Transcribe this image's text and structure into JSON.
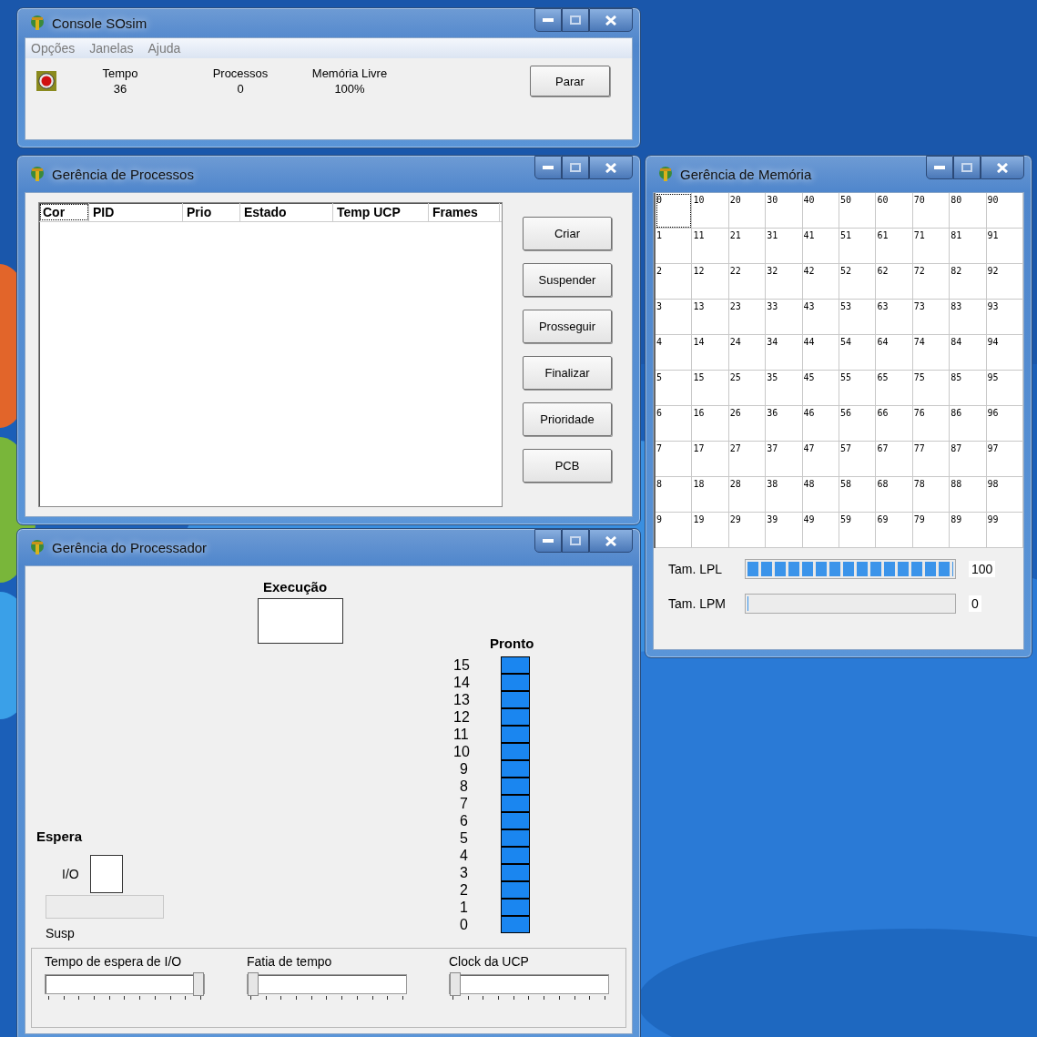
{
  "windows": [
    {
      "kind": "console",
      "title": "Console SOsim",
      "menu": [
        "Opções",
        "Janelas",
        "Ajuda"
      ],
      "stats": [
        {
          "label": "Tempo",
          "value": "36"
        },
        {
          "label": "Processos",
          "value": "0"
        },
        {
          "label": "Memória Livre",
          "value": "100%"
        }
      ],
      "button": "Parar"
    },
    {
      "kind": "processes",
      "title": "Gerência de Processos",
      "columns": [
        "Cor",
        "PID",
        "Prio",
        "Estado",
        "Temp UCP",
        "Frames"
      ],
      "buttons": [
        "Criar",
        "Suspender",
        "Prosseguir",
        "Finalizar",
        "Prioridade",
        "PCB"
      ]
    },
    {
      "kind": "memory",
      "title": "Gerência de Memória",
      "cells": [
        {
          "label": "0",
          "selected": true
        },
        {
          "label": "1",
          "selected": false
        },
        {
          "label": "2",
          "selected": false
        },
        {
          "label": "3",
          "selected": false
        },
        {
          "label": "4",
          "selected": false
        },
        {
          "label": "5",
          "selected": false
        },
        {
          "label": "6",
          "selected": false
        },
        {
          "label": "7",
          "selected": false
        },
        {
          "label": "8",
          "selected": false
        },
        {
          "label": "9",
          "selected": false
        },
        {
          "label": "10",
          "selected": false
        },
        {
          "label": "11",
          "selected": false
        },
        {
          "label": "12",
          "selected": false
        },
        {
          "label": "13",
          "selected": false
        },
        {
          "label": "14",
          "selected": false
        },
        {
          "label": "15",
          "selected": false
        },
        {
          "label": "16",
          "selected": false
        },
        {
          "label": "17",
          "selected": false
        },
        {
          "label": "18",
          "selected": false
        },
        {
          "label": "19",
          "selected": false
        },
        {
          "label": "20",
          "selected": false
        },
        {
          "label": "21",
          "selected": false
        },
        {
          "label": "22",
          "selected": false
        },
        {
          "label": "23",
          "selected": false
        },
        {
          "label": "24",
          "selected": false
        },
        {
          "label": "25",
          "selected": false
        },
        {
          "label": "26",
          "selected": false
        },
        {
          "label": "27",
          "selected": false
        },
        {
          "label": "28",
          "selected": false
        },
        {
          "label": "29",
          "selected": false
        },
        {
          "label": "30",
          "selected": false
        },
        {
          "label": "31",
          "selected": false
        },
        {
          "label": "32",
          "selected": false
        },
        {
          "label": "33",
          "selected": false
        },
        {
          "label": "34",
          "selected": false
        },
        {
          "label": "35",
          "selected": false
        },
        {
          "label": "36",
          "selected": false
        },
        {
          "label": "37",
          "selected": false
        },
        {
          "label": "38",
          "selected": false
        },
        {
          "label": "39",
          "selected": false
        },
        {
          "label": "40",
          "selected": false
        },
        {
          "label": "41",
          "selected": false
        },
        {
          "label": "42",
          "selected": false
        },
        {
          "label": "43",
          "selected": false
        },
        {
          "label": "44",
          "selected": false
        },
        {
          "label": "45",
          "selected": false
        },
        {
          "label": "46",
          "selected": false
        },
        {
          "label": "47",
          "selected": false
        },
        {
          "label": "48",
          "selected": false
        },
        {
          "label": "49",
          "selected": false
        },
        {
          "label": "50",
          "selected": false
        },
        {
          "label": "51",
          "selected": false
        },
        {
          "label": "52",
          "selected": false
        },
        {
          "label": "53",
          "selected": false
        },
        {
          "label": "54",
          "selected": false
        },
        {
          "label": "55",
          "selected": false
        },
        {
          "label": "56",
          "selected": false
        },
        {
          "label": "57",
          "selected": false
        },
        {
          "label": "58",
          "selected": false
        },
        {
          "label": "59",
          "selected": false
        },
        {
          "label": "60",
          "selected": false
        },
        {
          "label": "61",
          "selected": false
        },
        {
          "label": "62",
          "selected": false
        },
        {
          "label": "63",
          "selected": false
        },
        {
          "label": "64",
          "selected": false
        },
        {
          "label": "65",
          "selected": false
        },
        {
          "label": "66",
          "selected": false
        },
        {
          "label": "67",
          "selected": false
        },
        {
          "label": "68",
          "selected": false
        },
        {
          "label": "69",
          "selected": false
        },
        {
          "label": "70",
          "selected": false
        },
        {
          "label": "71",
          "selected": false
        },
        {
          "label": "72",
          "selected": false
        },
        {
          "label": "73",
          "selected": false
        },
        {
          "label": "74",
          "selected": false
        },
        {
          "label": "75",
          "selected": false
        },
        {
          "label": "76",
          "selected": false
        },
        {
          "label": "77",
          "selected": false
        },
        {
          "label": "78",
          "selected": false
        },
        {
          "label": "79",
          "selected": false
        },
        {
          "label": "80",
          "selected": false
        },
        {
          "label": "81",
          "selected": false
        },
        {
          "label": "82",
          "selected": false
        },
        {
          "label": "83",
          "selected": false
        },
        {
          "label": "84",
          "selected": false
        },
        {
          "label": "85",
          "selected": false
        },
        {
          "label": "86",
          "selected": false
        },
        {
          "label": "87",
          "selected": false
        },
        {
          "label": "88",
          "selected": false
        },
        {
          "label": "89",
          "selected": false
        },
        {
          "label": "90",
          "selected": false
        },
        {
          "label": "91",
          "selected": false
        },
        {
          "label": "92",
          "selected": false
        },
        {
          "label": "93",
          "selected": false
        },
        {
          "label": "94",
          "selected": false
        },
        {
          "label": "95",
          "selected": false
        },
        {
          "label": "96",
          "selected": false
        },
        {
          "label": "97",
          "selected": false
        },
        {
          "label": "98",
          "selected": false
        },
        {
          "label": "99",
          "selected": false
        }
      ],
      "queues": [
        {
          "label": "Tam. LPL",
          "level": 1,
          "reading": "100"
        },
        {
          "label": "Tam. LPM",
          "level": 0,
          "reading": "0"
        }
      ]
    },
    {
      "kind": "processor",
      "title": "Gerência do Processador",
      "execution_label": "Execução",
      "ready_label": "Pronto",
      "ready_queue": [
        "15",
        "14",
        "13",
        "12",
        "11",
        "10",
        "9",
        "8",
        "7",
        "6",
        "5",
        "4",
        "3",
        "2",
        "1",
        "0"
      ],
      "wait_label": "Espera",
      "io_label": "I/O",
      "susp_label": "Susp",
      "sliders": [
        {
          "label": "Tempo de espera de I/O",
          "level": 1
        },
        {
          "label": "Fatia de tempo",
          "level": 0
        },
        {
          "label": "Clock da UCP",
          "level": 0
        }
      ]
    }
  ]
}
